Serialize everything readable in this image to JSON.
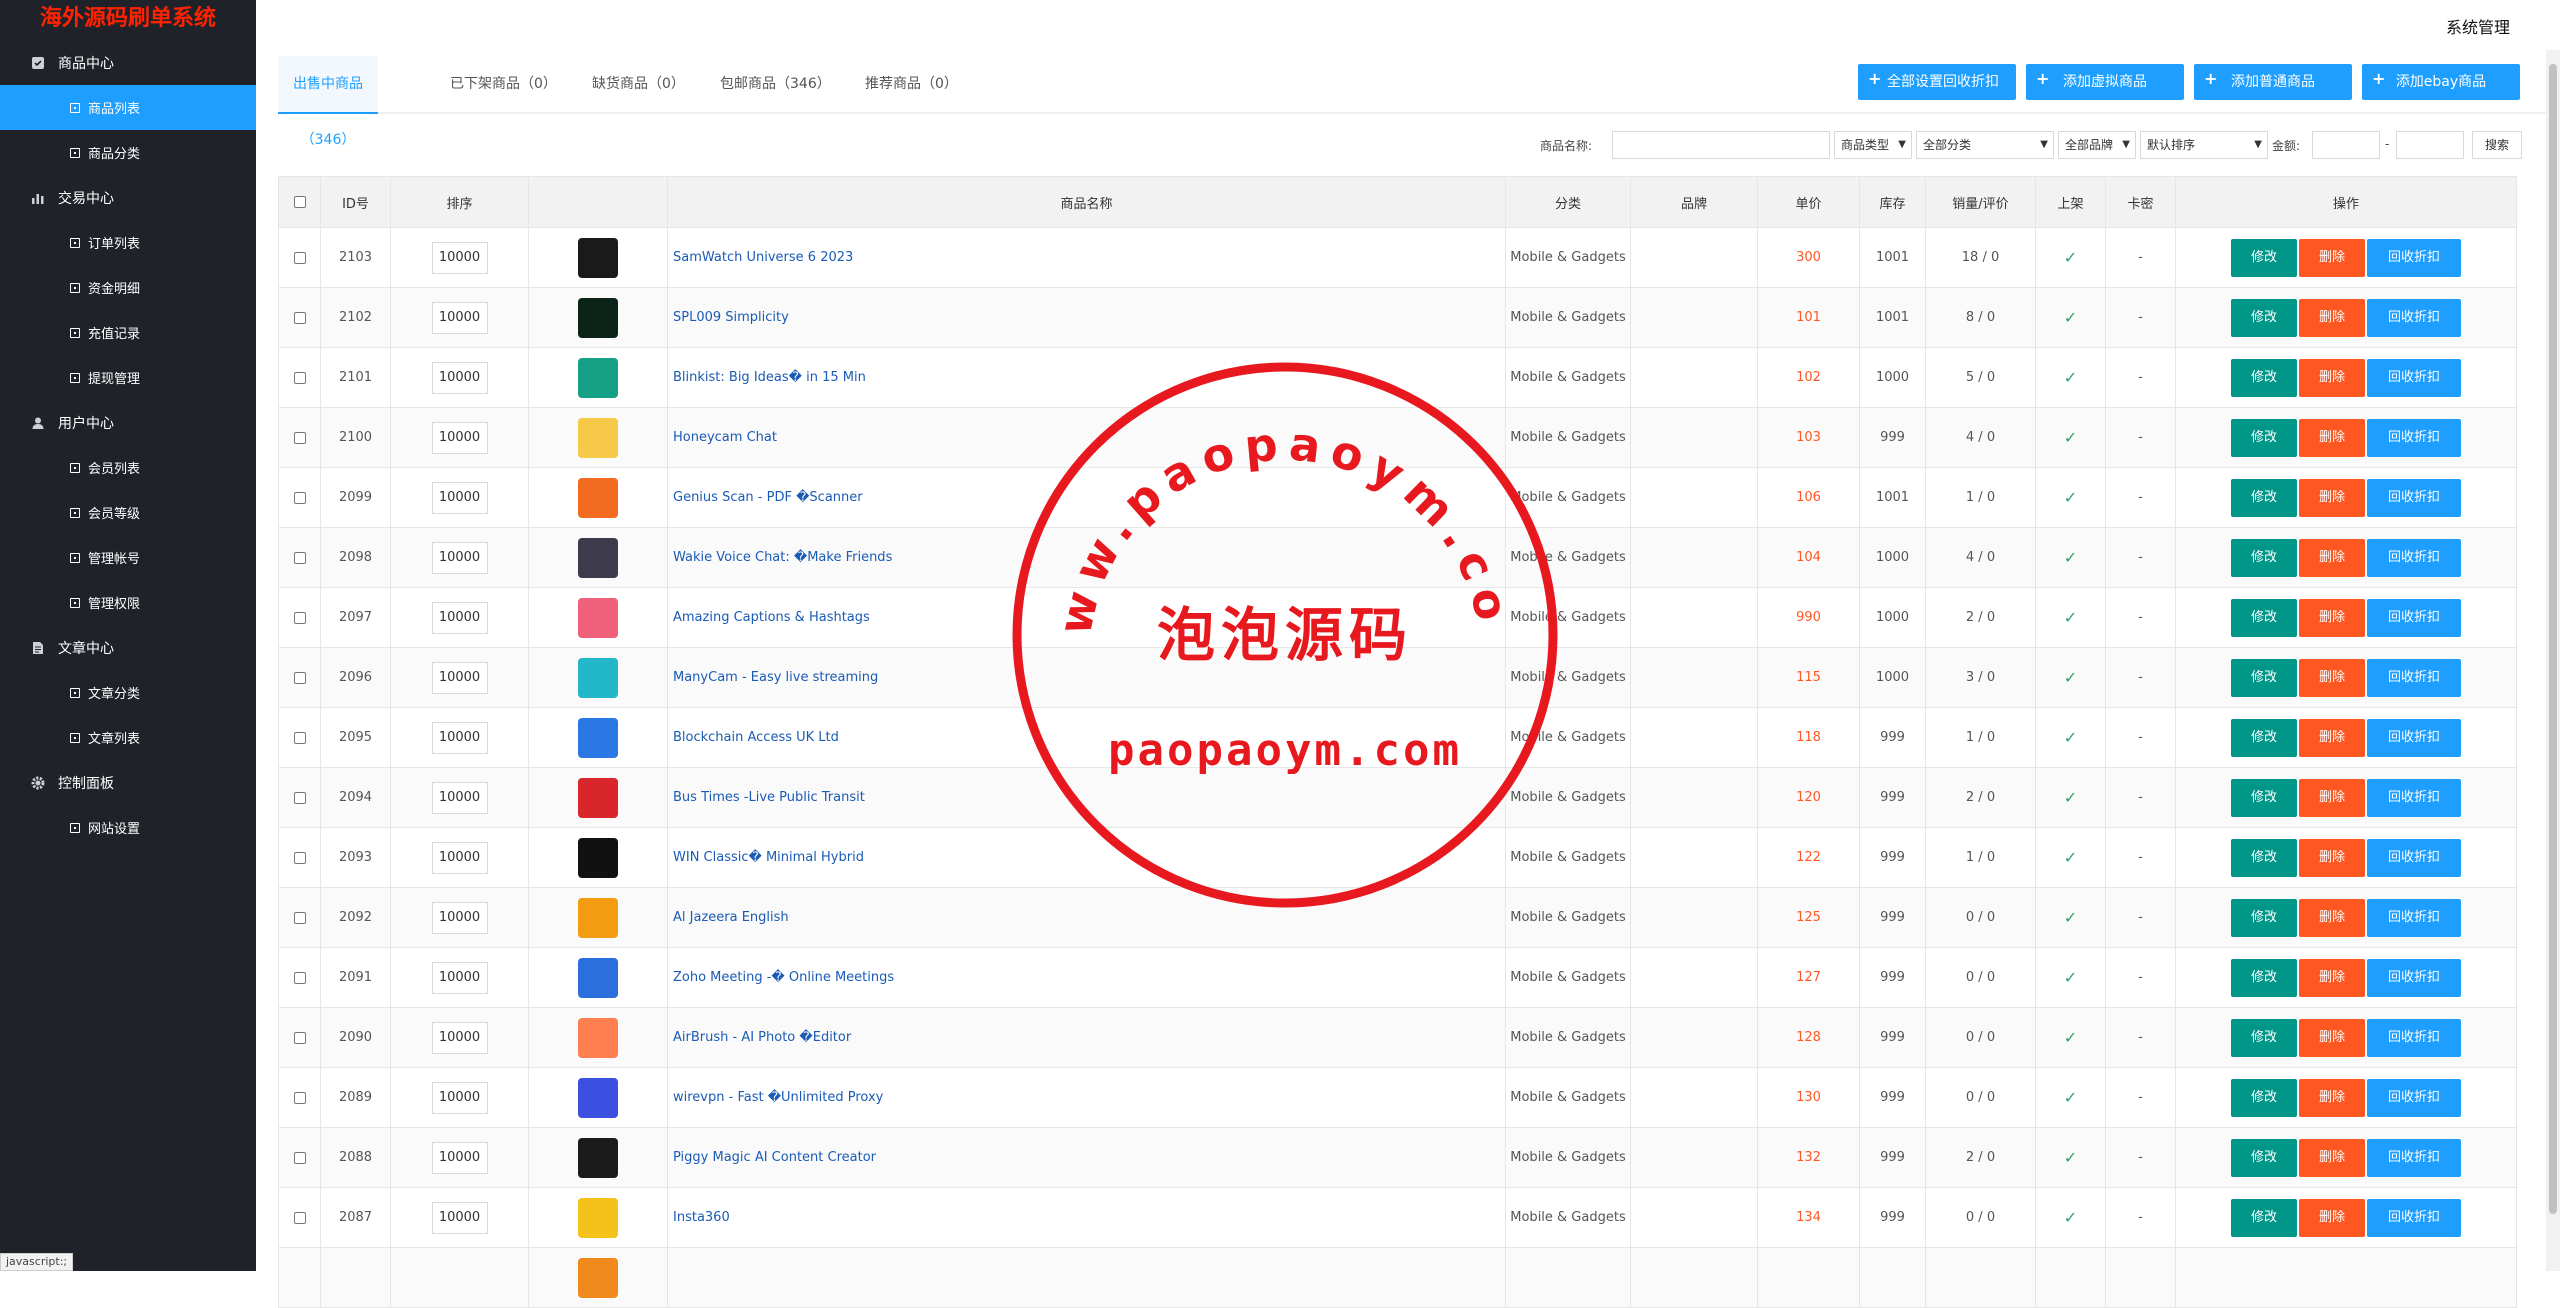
{
  "brand": "海外源码刷单系统",
  "header_title": "系统管理",
  "status_bar": "javascript:;",
  "sidebar": {
    "groups": [
      {
        "label": "商品中心",
        "icon": "product-icon",
        "items": [
          {
            "label": "商品列表",
            "active": true
          },
          {
            "label": "商品分类"
          }
        ]
      },
      {
        "label": "交易中心",
        "icon": "chart-icon",
        "items": [
          {
            "label": "订单列表"
          },
          {
            "label": "资金明细"
          },
          {
            "label": "充值记录"
          },
          {
            "label": "提现管理"
          }
        ]
      },
      {
        "label": "用户中心",
        "icon": "user-icon",
        "items": [
          {
            "label": "会员列表"
          },
          {
            "label": "会员等级"
          },
          {
            "label": "管理帐号"
          },
          {
            "label": "管理权限"
          }
        ]
      },
      {
        "label": "文章中心",
        "icon": "document-icon",
        "items": [
          {
            "label": "文章分类"
          },
          {
            "label": "文章列表"
          }
        ]
      },
      {
        "label": "控制面板",
        "icon": "gear-icon",
        "items": [
          {
            "label": "网站设置"
          }
        ]
      }
    ]
  },
  "tabs": [
    {
      "label": "出售中商品（346）",
      "active": true
    },
    {
      "label": "已下架商品（0）"
    },
    {
      "label": "缺货商品（0）"
    },
    {
      "label": "包邮商品（346）"
    },
    {
      "label": "推荐商品（0）"
    }
  ],
  "top_buttons": {
    "set_all_recycle": "全部设置回收折扣",
    "add_virtual": "添加虚拟商品",
    "add_normal": "添加普通商品",
    "add_ebay": "添加ebay商品"
  },
  "search": {
    "name_label": "商品名称:",
    "type_select": "商品类型",
    "category_select": "全部分类",
    "brand_select": "全部品牌",
    "sort_select": "默认排序",
    "amount_label": "金额:",
    "dash": "-",
    "search_button": "搜索"
  },
  "table": {
    "columns": [
      "",
      "ID号",
      "排序",
      "",
      "商品名称",
      "分类",
      "品牌",
      "单价",
      "库存",
      "销量/评价",
      "上架",
      "卡密",
      "操作"
    ],
    "action_labels": {
      "edit": "修改",
      "delete": "删除",
      "recycle": "回收折扣"
    },
    "onsale_mark": "✓",
    "rows": [
      {
        "id": "2103",
        "sort": "10000",
        "name": "SamWatch Universe 6 2023",
        "category": "Mobile & Gadgets",
        "brand": "",
        "price": "300",
        "stock": "1001",
        "sales": "18 / 0",
        "card": "-",
        "thumb_color": "#1a1a1a"
      },
      {
        "id": "2102",
        "sort": "10000",
        "name": "SPL009 Simplicity",
        "category": "Mobile & Gadgets",
        "brand": "",
        "price": "101",
        "stock": "1001",
        "sales": "8 / 0",
        "card": "-",
        "thumb_color": "#0c2318"
      },
      {
        "id": "2101",
        "sort": "10000",
        "name": "Blinkist: Big Ideas� in 15 Min",
        "category": "Mobile & Gadgets",
        "brand": "",
        "price": "102",
        "stock": "1000",
        "sales": "5 / 0",
        "card": "-",
        "thumb_color": "#16a085"
      },
      {
        "id": "2100",
        "sort": "10000",
        "name": "Honeycam Chat",
        "category": "Mobile & Gadgets",
        "brand": "",
        "price": "103",
        "stock": "999",
        "sales": "4 / 0",
        "card": "-",
        "thumb_color": "#f7c948"
      },
      {
        "id": "2099",
        "sort": "10000",
        "name": "Genius Scan - PDF �Scanner",
        "category": "Mobile & Gadgets",
        "brand": "",
        "price": "106",
        "stock": "1001",
        "sales": "1 / 0",
        "card": "-",
        "thumb_color": "#f26b21"
      },
      {
        "id": "2098",
        "sort": "10000",
        "name": "Wakie Voice Chat: �Make Friends",
        "category": "Mobile & Gadgets",
        "brand": "",
        "price": "104",
        "stock": "1000",
        "sales": "4 / 0",
        "card": "-",
        "thumb_color": "#3d3a4b"
      },
      {
        "id": "2097",
        "sort": "10000",
        "name": "Amazing Captions & Hashtags",
        "category": "Mobile & Gadgets",
        "brand": "",
        "price": "990",
        "stock": "1000",
        "sales": "2 / 0",
        "card": "-",
        "thumb_color": "#f0607a"
      },
      {
        "id": "2096",
        "sort": "10000",
        "name": "ManyCam - Easy live streaming",
        "category": "Mobile & Gadgets",
        "brand": "",
        "price": "115",
        "stock": "1000",
        "sales": "3 / 0",
        "card": "-",
        "thumb_color": "#22b7c9"
      },
      {
        "id": "2095",
        "sort": "10000",
        "name": "Blockchain Access UK Ltd",
        "category": "Mobile & Gadgets",
        "brand": "",
        "price": "118",
        "stock": "999",
        "sales": "1 / 0",
        "card": "-",
        "thumb_color": "#2b78e4"
      },
      {
        "id": "2094",
        "sort": "10000",
        "name": "Bus Times -Live Public Transit",
        "category": "Mobile & Gadgets",
        "brand": "",
        "price": "120",
        "stock": "999",
        "sales": "2 / 0",
        "card": "-",
        "thumb_color": "#d9262a"
      },
      {
        "id": "2093",
        "sort": "10000",
        "name": "WIN Classic� Minimal Hybrid",
        "category": "Mobile & Gadgets",
        "brand": "",
        "price": "122",
        "stock": "999",
        "sales": "1 / 0",
        "card": "-",
        "thumb_color": "#111111"
      },
      {
        "id": "2092",
        "sort": "10000",
        "name": "Al Jazeera English",
        "category": "Mobile & Gadgets",
        "brand": "",
        "price": "125",
        "stock": "999",
        "sales": "0 / 0",
        "card": "-",
        "thumb_color": "#f39c12"
      },
      {
        "id": "2091",
        "sort": "10000",
        "name": "Zoho Meeting -� Online Meetings",
        "category": "Mobile & Gadgets",
        "brand": "",
        "price": "127",
        "stock": "999",
        "sales": "0 / 0",
        "card": "-",
        "thumb_color": "#2a6fdb"
      },
      {
        "id": "2090",
        "sort": "10000",
        "name": "AirBrush - AI Photo �Editor",
        "category": "Mobile & Gadgets",
        "brand": "",
        "price": "128",
        "stock": "999",
        "sales": "0 / 0",
        "card": "-",
        "thumb_color": "#ff7f50"
      },
      {
        "id": "2089",
        "sort": "10000",
        "name": "wirevpn - Fast �Unlimited Proxy",
        "category": "Mobile & Gadgets",
        "brand": "",
        "price": "130",
        "stock": "999",
        "sales": "0 / 0",
        "card": "-",
        "thumb_color": "#3b4fe0"
      },
      {
        "id": "2088",
        "sort": "10000",
        "name": "Piggy Magic AI Content Creator",
        "category": "Mobile & Gadgets",
        "brand": "",
        "price": "132",
        "stock": "999",
        "sales": "2 / 0",
        "card": "-",
        "thumb_color": "#1b1b1b"
      },
      {
        "id": "2087",
        "sort": "10000",
        "name": "Insta360",
        "category": "Mobile & Gadgets",
        "brand": "",
        "price": "134",
        "stock": "999",
        "sales": "0 / 0",
        "card": "-",
        "thumb_color": "#f4c21a"
      },
      {
        "id": "",
        "sort": "",
        "name": "",
        "category": "",
        "brand": "",
        "price": "",
        "stock": "",
        "sales": "",
        "card": "",
        "thumb_color": "#f08a1c"
      }
    ]
  },
  "watermark": {
    "top_arc": "www.paopaoym.com",
    "center": "泡泡源码",
    "bottom": "paopaoym.com",
    "color": "#e8191e"
  }
}
